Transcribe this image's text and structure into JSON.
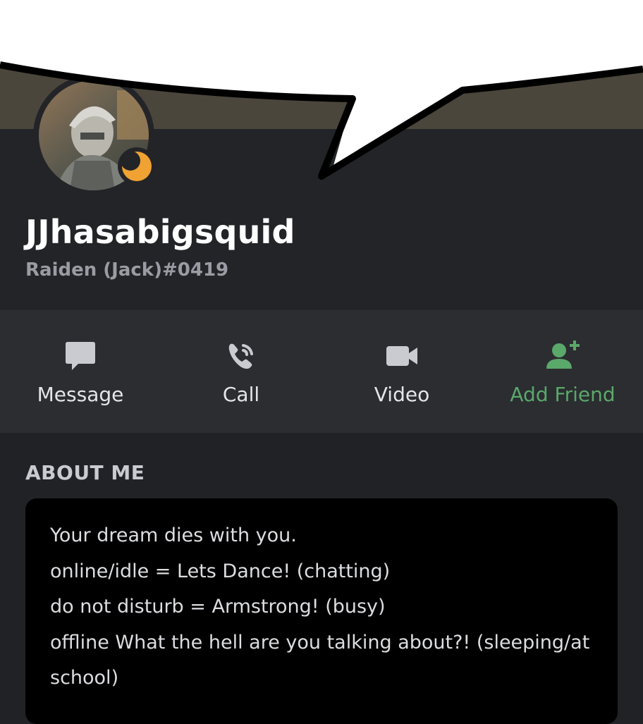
{
  "profile": {
    "username": "JJhasabigsquid",
    "tag": "Raiden (Jack)#0419",
    "status": "idle",
    "colors": {
      "banner": "#4b463c",
      "status_idle": "#f0a232",
      "accent_green": "#5aa86a"
    }
  },
  "actions": [
    {
      "label": "Message",
      "icon": "message-icon"
    },
    {
      "label": "Call",
      "icon": "phone-call-icon"
    },
    {
      "label": "Video",
      "icon": "video-camera-icon"
    },
    {
      "label": "Add Friend",
      "icon": "add-friend-icon"
    }
  ],
  "about": {
    "title": "ABOUT ME",
    "lines": [
      "Your dream dies with you.",
      "online/idle = Lets Dance! (chatting)",
      "do not disturb = Armstrong! (busy)",
      "offline What the hell are you talking about?! (sleeping/at school)"
    ]
  }
}
